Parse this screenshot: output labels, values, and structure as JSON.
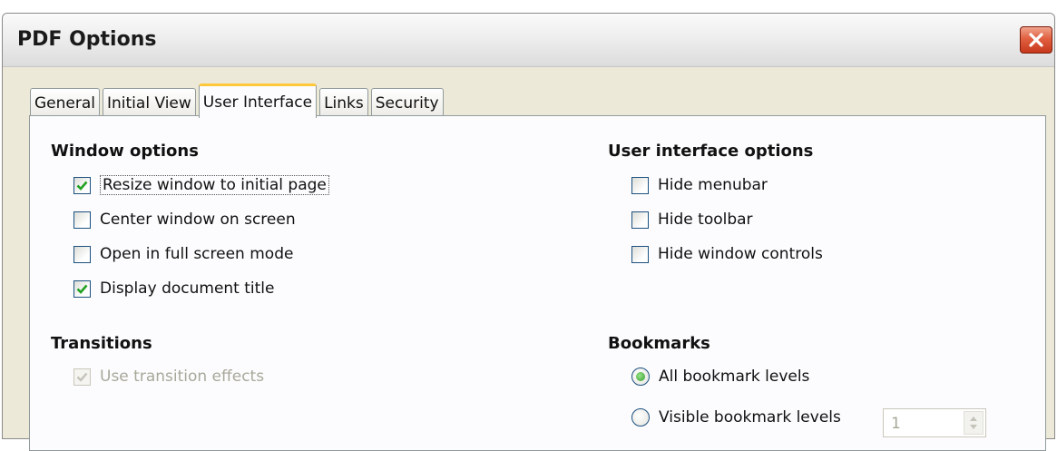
{
  "window": {
    "title": "PDF Options"
  },
  "tabs": [
    {
      "label": "General",
      "active": false
    },
    {
      "label": "Initial View",
      "active": false
    },
    {
      "label": "User Interface",
      "active": true
    },
    {
      "label": "Links",
      "active": false
    },
    {
      "label": "Security",
      "active": false
    }
  ],
  "window_options": {
    "title": "Window options",
    "items": [
      {
        "label": "Resize window to initial page",
        "checked": true
      },
      {
        "label": "Center window on screen",
        "checked": false
      },
      {
        "label": "Open in full screen mode",
        "checked": false
      },
      {
        "label": "Display document title",
        "checked": true
      }
    ]
  },
  "ui_options": {
    "title": "User interface options",
    "items": [
      {
        "label": "Hide menubar",
        "checked": false
      },
      {
        "label": "Hide toolbar",
        "checked": false
      },
      {
        "label": "Hide window controls",
        "checked": false
      }
    ]
  },
  "transitions": {
    "title": "Transitions",
    "use_transition_label": "Use transition effects",
    "checked": true,
    "enabled": false
  },
  "bookmarks": {
    "title": "Bookmarks",
    "all_levels_label": "All bookmark levels",
    "visible_levels_label": "Visible bookmark levels",
    "selected": "all",
    "levels_value": "1"
  },
  "colors": {
    "accent_tab": "#ffc83c",
    "check": "#21a121",
    "close_button": "#e06040"
  },
  "icons": {
    "close": "close-icon",
    "check": "checkmark-icon"
  }
}
